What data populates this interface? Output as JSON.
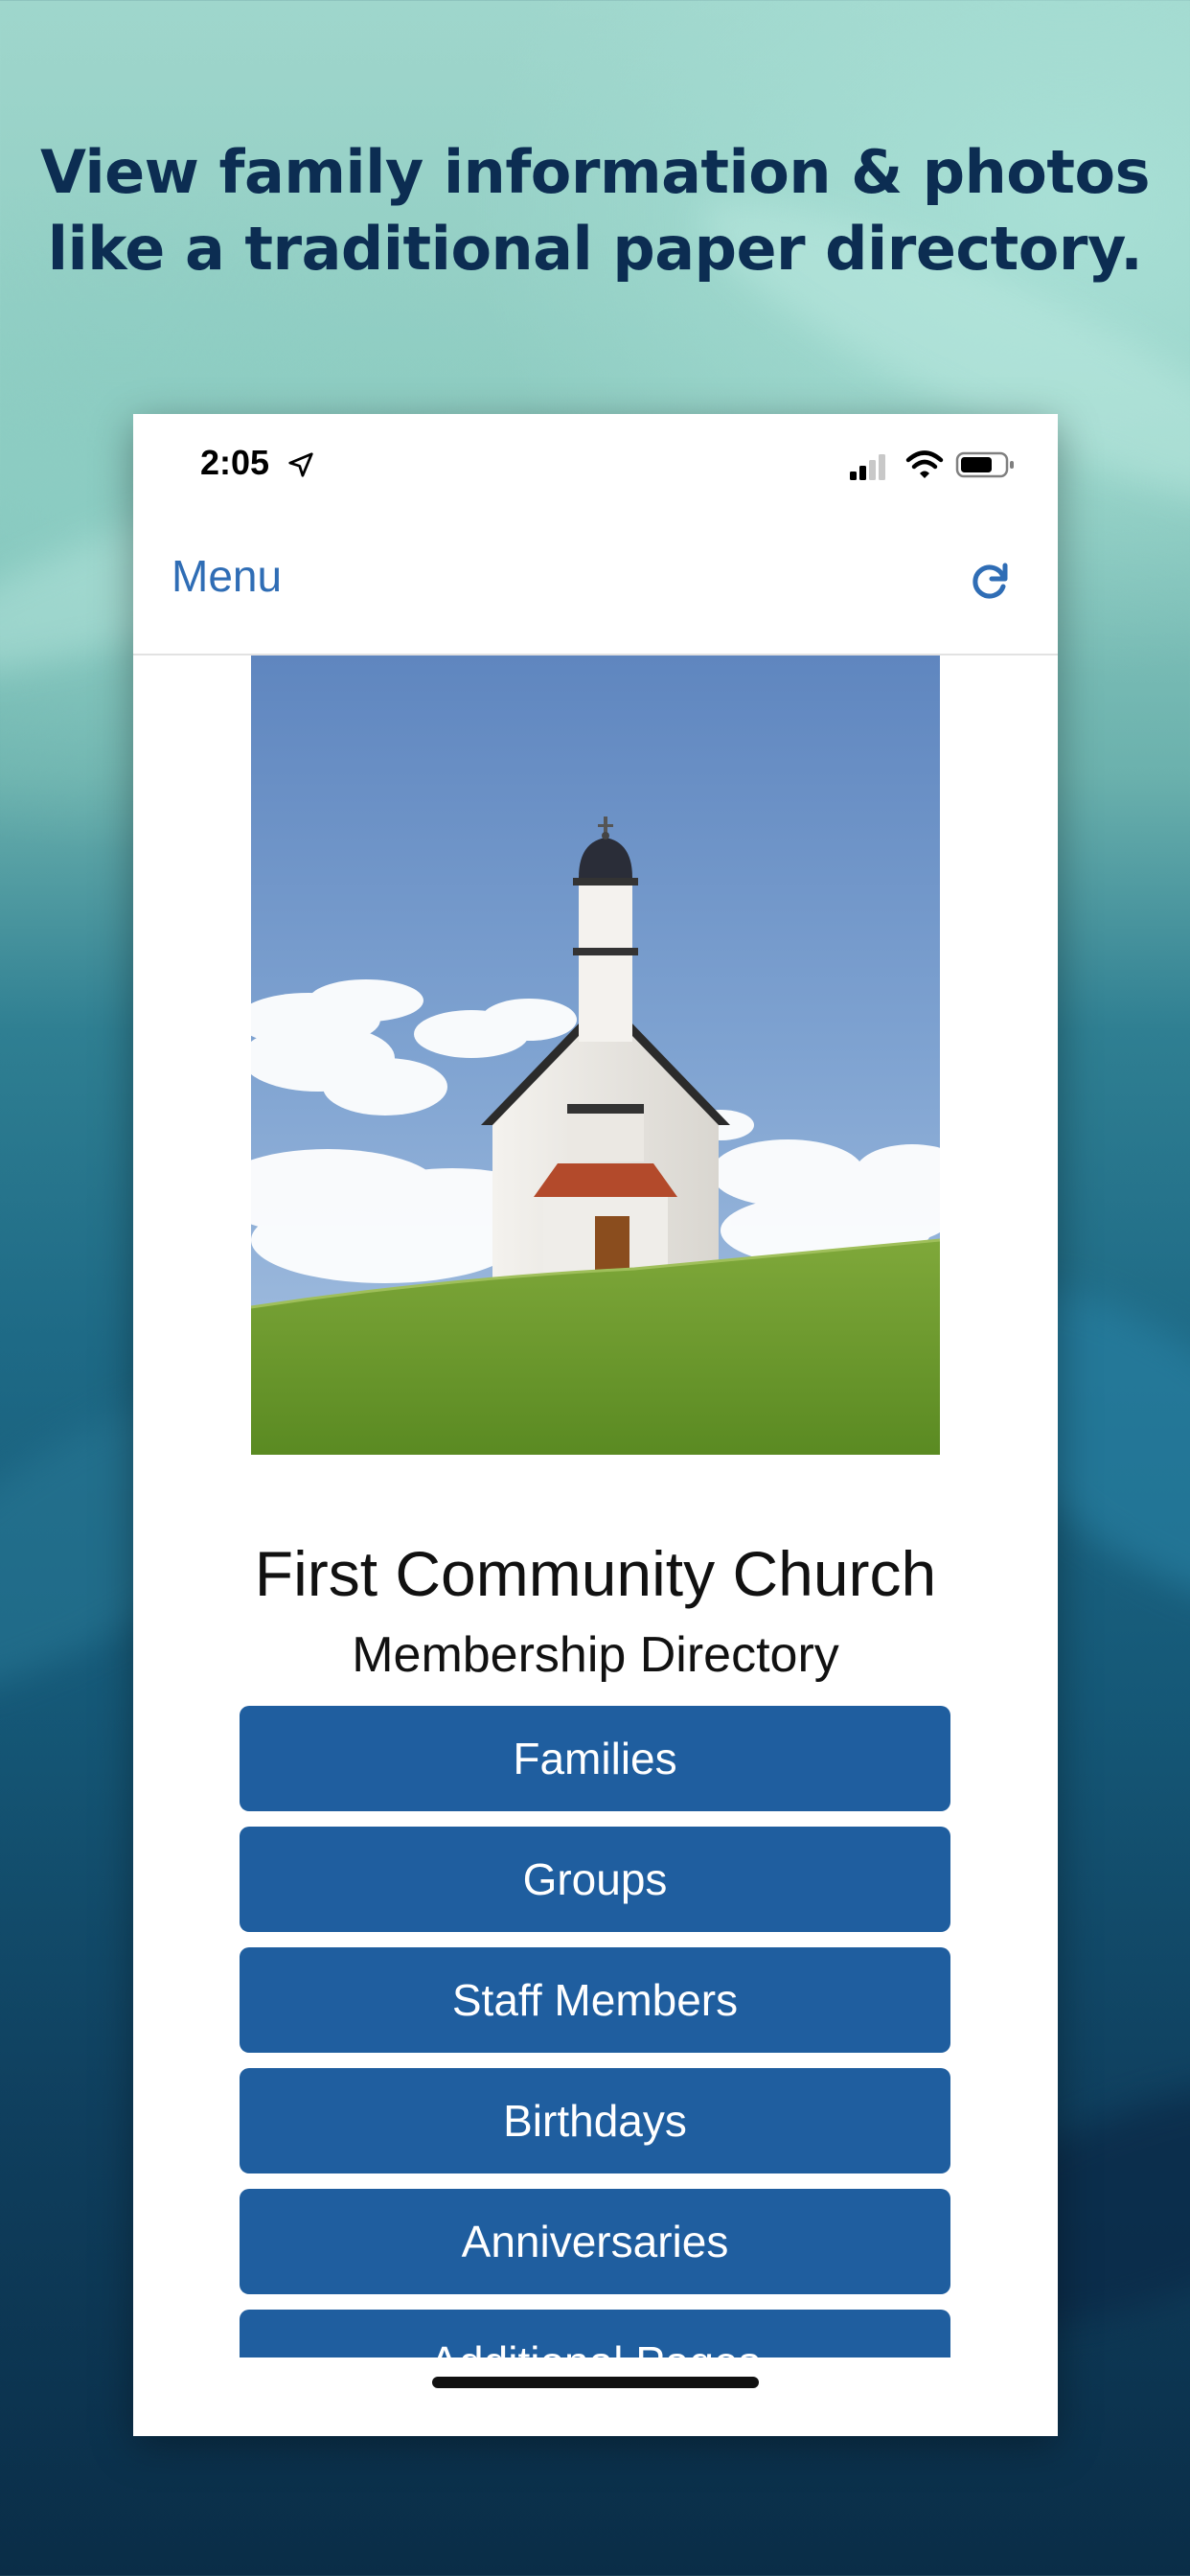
{
  "promo": {
    "headline_line1": "View family information & photos",
    "headline_line2": "like a traditional paper directory."
  },
  "status_bar": {
    "time": "2:05",
    "icons": [
      "location-arrow-icon",
      "cellular-signal-icon",
      "wifi-icon",
      "battery-icon"
    ]
  },
  "nav_bar": {
    "menu_label": "Menu",
    "refresh_icon": "refresh-icon",
    "accent_color": "#2f6db5"
  },
  "main": {
    "hero_image": "white church on green hill under blue sky",
    "title": "First Community Church",
    "subtitle": "Membership Directory",
    "button_color": "#1f5e9f",
    "buttons": [
      {
        "label": "Families"
      },
      {
        "label": "Groups"
      },
      {
        "label": "Staff Members"
      },
      {
        "label": "Birthdays"
      },
      {
        "label": "Anniversaries"
      },
      {
        "label": "Additional Pages"
      }
    ]
  }
}
